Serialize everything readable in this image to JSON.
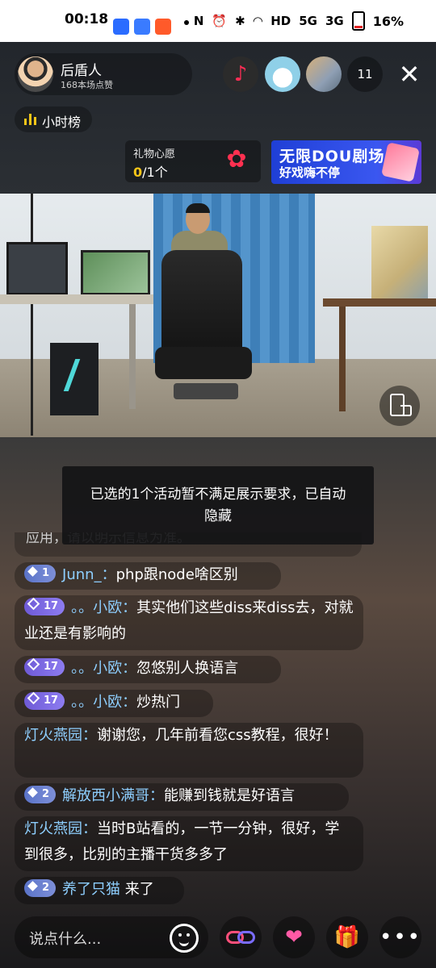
{
  "status_bar": {
    "time": "00:18",
    "network_5g": "5G",
    "network_3g": "3G",
    "battery": "16%"
  },
  "streamer": {
    "name": "后盾人",
    "likes": "168本场点赞"
  },
  "viewers": {
    "count": "11"
  },
  "rank": {
    "label": "小时榜"
  },
  "gift_wish": {
    "title": "礼物心愿",
    "current": "0",
    "target": "/1个"
  },
  "banner": {
    "line1": "无限DOU剧场",
    "line2": "好戏嗨不停"
  },
  "toast": {
    "text": "已选的1个活动暂不满足展示要求，已自动隐藏"
  },
  "comments": {
    "partial_text": "应用，请以明示信息为准。",
    "items": [
      {
        "level": "1",
        "user": "Junn_：",
        "text": "php跟node啥区别"
      },
      {
        "level": "17",
        "user": "。。小欧：",
        "text": "其实他们这些diss来diss去，对就业还是有影响的"
      },
      {
        "level": "17",
        "user": "。。小欧：",
        "text": "忽悠别人换语言"
      },
      {
        "level": "17",
        "user": "。。小欧：",
        "text": "炒热门"
      },
      {
        "level": "",
        "user": "灯火燕园：",
        "text": "谢谢您，几年前看您css教程，很好！"
      },
      {
        "level": "2",
        "user": "解放西小满哥：",
        "text": "能赚到钱就是好语言"
      },
      {
        "level": "",
        "user": "灯火燕园：",
        "text": "当时B站看的，一节一分钟，很好，学到很多，比别的主播干货多多了"
      },
      {
        "level": "2",
        "user": "养了只猫",
        "text": " 来了"
      }
    ]
  },
  "bottom_bar": {
    "input_placeholder": "说点什么..."
  },
  "icons": {
    "music": "music-note-icon",
    "close": "close-icon",
    "emoji": "emoji-icon",
    "link": "link-icon",
    "heart": "heart-icon",
    "gift": "gift-icon",
    "more": "more-icon",
    "rotate": "rotate-screen-icon"
  },
  "colors": {
    "username": "#8ecfff",
    "rank_accent": "#f5c518",
    "banner_bg": "#1f3fd6"
  }
}
